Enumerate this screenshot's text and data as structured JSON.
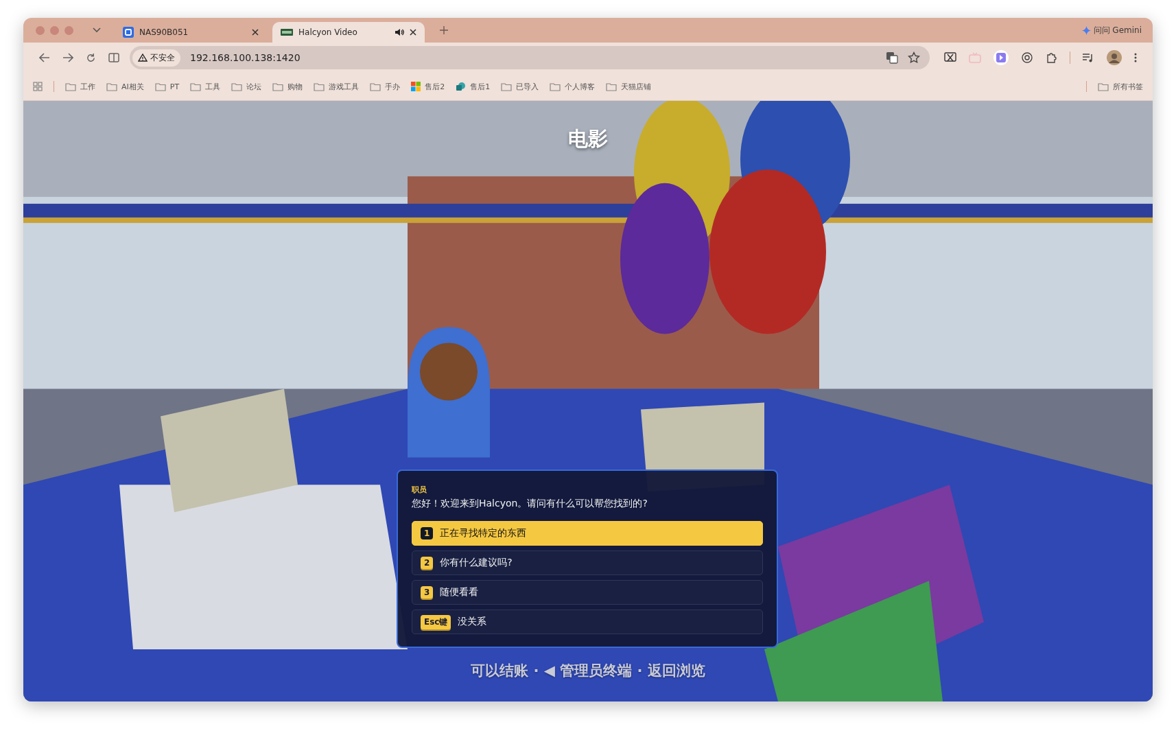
{
  "tabs": [
    {
      "title": "NAS90B051",
      "selected": false,
      "audio": false
    },
    {
      "title": "Halcyon Video",
      "selected": true,
      "audio": true
    }
  ],
  "gemini": "问问 Gemini",
  "address": {
    "security": "不安全",
    "url": "192.168.100.138:1420"
  },
  "bookmarks": [
    {
      "label": "工作",
      "kind": "folder"
    },
    {
      "label": "AI相关",
      "kind": "folder"
    },
    {
      "label": "PT",
      "kind": "folder"
    },
    {
      "label": "工具",
      "kind": "folder"
    },
    {
      "label": "论坛",
      "kind": "folder"
    },
    {
      "label": "购物",
      "kind": "folder"
    },
    {
      "label": "游戏工具",
      "kind": "folder"
    },
    {
      "label": "手办",
      "kind": "folder"
    },
    {
      "label": "售后2",
      "kind": "tiles"
    },
    {
      "label": "售后1",
      "kind": "app"
    },
    {
      "label": "已导入",
      "kind": "folder"
    },
    {
      "label": "个人博客",
      "kind": "folder"
    },
    {
      "label": "天猫店铺",
      "kind": "folder"
    }
  ],
  "all_bookmarks": "所有书签",
  "game": {
    "location": "电影",
    "dialog": {
      "speaker": "职员",
      "message": "您好！欢迎来到Halcyon。请问有什么可以帮您找到的?",
      "options": [
        {
          "key": "1",
          "label": "正在寻找特定的东西",
          "selected": true
        },
        {
          "key": "2",
          "label": "你有什么建议吗?",
          "selected": false
        },
        {
          "key": "3",
          "label": "随便看看",
          "selected": false
        },
        {
          "key": "Esc键",
          "label": "没关系",
          "selected": false
        }
      ]
    },
    "hint": "可以结账 · ◀ 管理员终端 · 返回浏览"
  }
}
